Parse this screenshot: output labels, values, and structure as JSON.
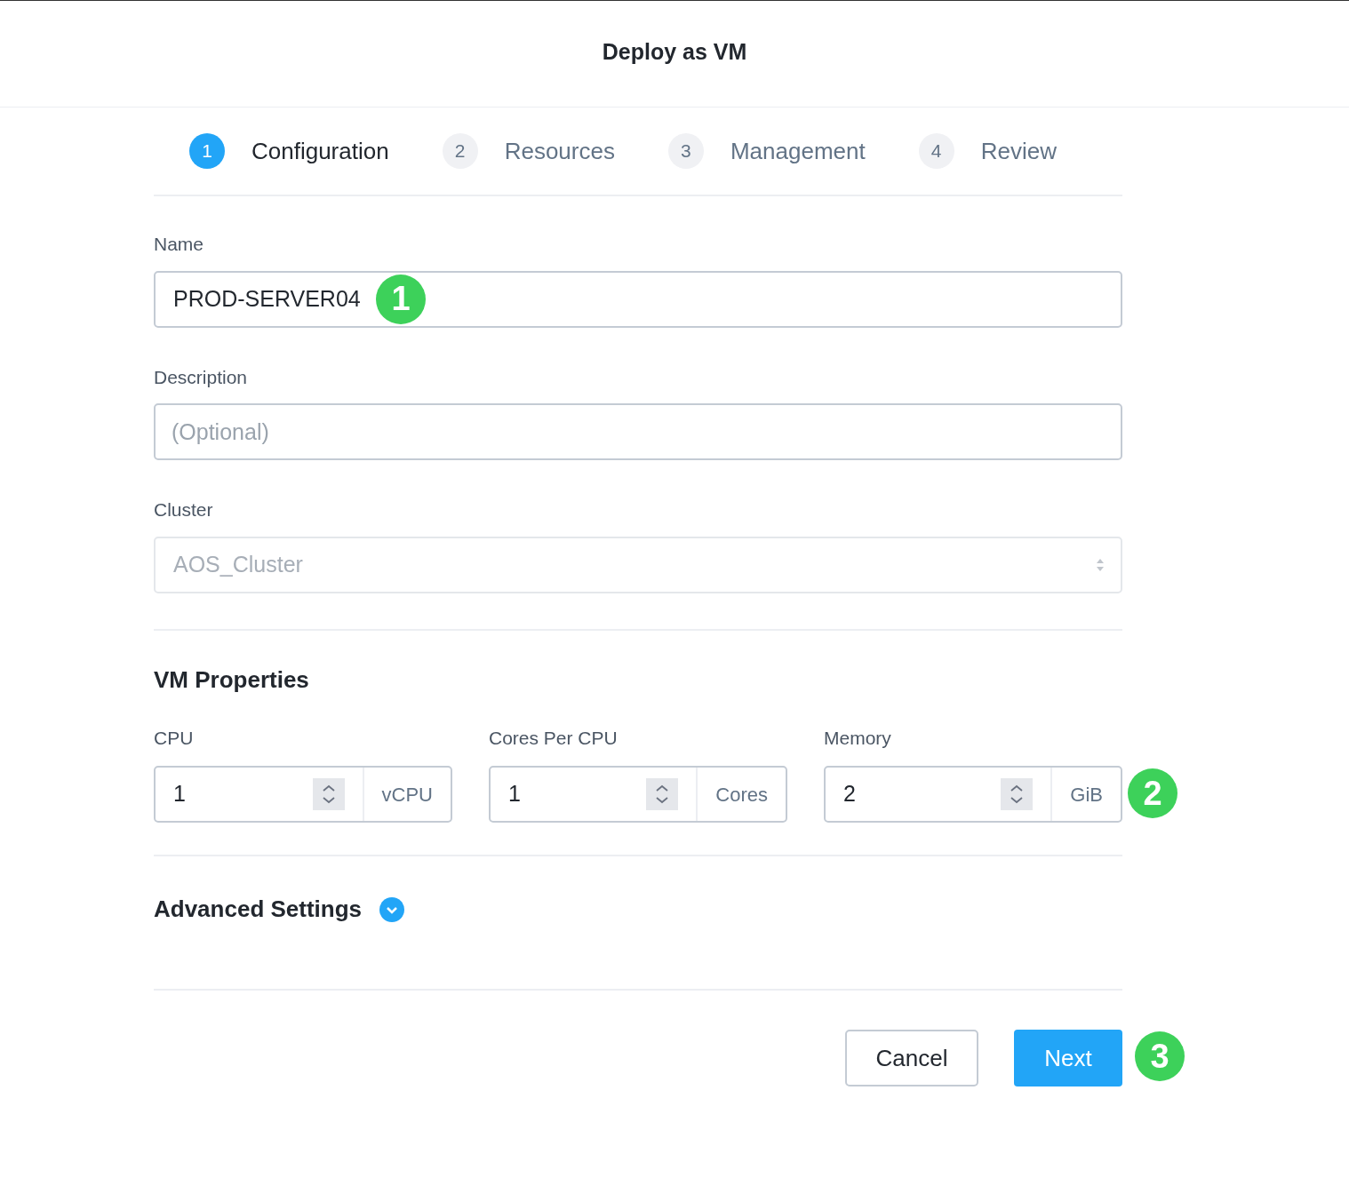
{
  "dialog": {
    "title": "Deploy as VM"
  },
  "steps": [
    {
      "number": "1",
      "label": "Configuration",
      "selected": true
    },
    {
      "number": "2",
      "label": "Resources",
      "selected": false
    },
    {
      "number": "3",
      "label": "Management",
      "selected": false
    },
    {
      "number": "4",
      "label": "Review",
      "selected": false
    }
  ],
  "name": {
    "label": "Name",
    "value": "PROD-SERVER04",
    "callout": "1"
  },
  "description": {
    "label": "Description",
    "placeholder": "(Optional)"
  },
  "cluster": {
    "label": "Cluster",
    "value": "AOS_Cluster",
    "disabled": true
  },
  "vm_properties": {
    "heading": "VM Properties",
    "fields": [
      {
        "label": "CPU",
        "value": "1",
        "unit": "vCPU"
      },
      {
        "label": "Cores Per CPU",
        "value": "1",
        "unit": "Cores"
      },
      {
        "label": "Memory",
        "value": "2",
        "unit": "GiB",
        "callout": "2"
      }
    ]
  },
  "advanced_settings": {
    "label": "Advanced Settings",
    "expanded": false
  },
  "buttons": {
    "cancel": "Cancel",
    "next": "Next",
    "next_callout": "3"
  }
}
